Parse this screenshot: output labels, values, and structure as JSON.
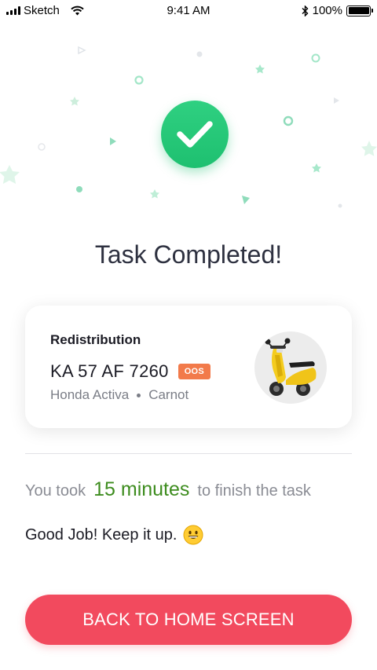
{
  "status_bar": {
    "carrier": "Sketch",
    "time": "9:41 AM",
    "battery": "100%"
  },
  "success_icon": "check-icon",
  "title": "Task Completed!",
  "task_card": {
    "type": "Redistribution",
    "plate": "KA 57 AF 7260",
    "badge": "OOS",
    "model": "Honda Activa",
    "location": "Carnot",
    "image": "scooter-image"
  },
  "duration": {
    "prefix": "You took",
    "value": "15 minutes",
    "suffix": "to finish the task"
  },
  "praise": {
    "text": "Good Job! Keep it up.",
    "emoji": "grinning-face-emoji"
  },
  "action_button": {
    "label": "BACK TO HOME SCREEN"
  },
  "colors": {
    "success": "#1ec070",
    "accent_button": "#f24a5e",
    "badge": "#f27a4a",
    "duration_value": "#3d8c1e"
  }
}
